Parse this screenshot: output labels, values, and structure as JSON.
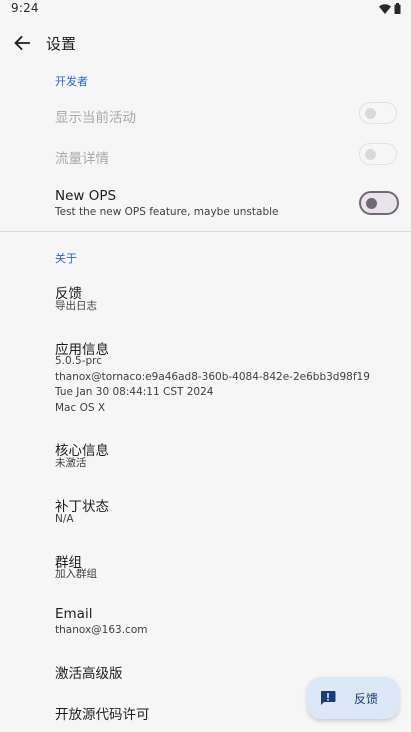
{
  "status_bar": {
    "time": "9:24"
  },
  "toolbar": {
    "title": "设置"
  },
  "developer": {
    "header": "开发者",
    "show_activity": {
      "title": "显示当前活动",
      "enabled": false
    },
    "traffic_details": {
      "title": "流量详情",
      "enabled": false
    },
    "new_ops": {
      "title": "New OPS",
      "summary": "Test the new OPS feature, maybe unstable",
      "enabled": true
    }
  },
  "about": {
    "header": "关于",
    "feedback": {
      "title": "反馈",
      "summary": "导出日志"
    },
    "app_info": {
      "title": "应用信息",
      "lines": [
        "5.0.5-prc",
        "thanox@tornaco:e9a46ad8-360b-4084-842e-2e6bb3d98f19",
        "Tue Jan 30 08:44:11 CST 2024",
        "Mac OS X"
      ]
    },
    "core_info": {
      "title": "核心信息",
      "summary": "未激活"
    },
    "patch_status": {
      "title": "补丁状态",
      "summary": "N/A"
    },
    "group": {
      "title": "群组",
      "summary": "加入群组"
    },
    "email": {
      "title": "Email",
      "summary": "thanox@163.com"
    },
    "activate_premium": {
      "title": "激活高级版"
    },
    "open_source_licenses": {
      "title": "开放源代码许可"
    }
  },
  "fab": {
    "label": "反馈",
    "icon": "feedback-icon"
  },
  "colors": {
    "accent": "#2f66c8",
    "fab_background": "#dde8f6",
    "background": "#f6f6f6"
  }
}
